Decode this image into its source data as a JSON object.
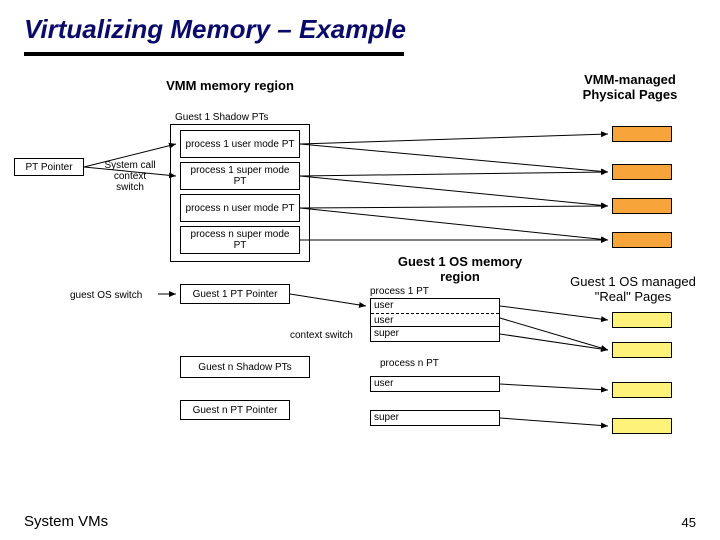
{
  "title": "Virtualizing Memory – Example",
  "labels": {
    "vmm_region": "VMM memory region",
    "vmm_pages": "VMM-managed\nPhysical Pages",
    "guest1_shadow": "Guest 1 Shadow PTs",
    "pt_pointer": "PT Pointer",
    "syscall": "System call context switch",
    "p1_user": "process 1 user mode PT",
    "p1_super": "process 1 super mode PT",
    "pn_user": "process n user mode PT",
    "pn_super": "process n super mode PT",
    "guest_os_switch": "guest OS switch",
    "guest1_pt_pointer": "Guest 1 PT Pointer",
    "context_switch": "context switch",
    "guestn_shadow": "Guest n  Shadow PTs",
    "guestn_pt_pointer": "Guest n PT Pointer",
    "guest1_os_region": "Guest 1 OS memory region",
    "guest1_real_pages": "Guest 1 OS managed \"Real\" Pages",
    "process1_pt": "process 1 PT",
    "processn_pt": "process n PT",
    "user": "user",
    "super": "super"
  },
  "footer": {
    "left": "System VMs",
    "right": "45"
  }
}
